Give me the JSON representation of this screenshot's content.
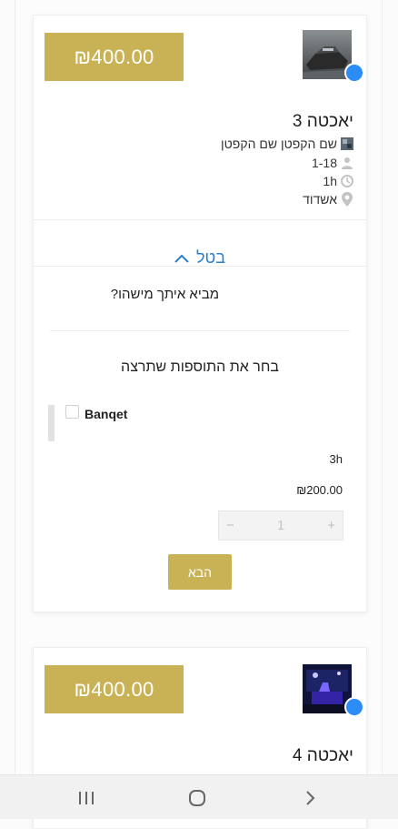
{
  "colors": {
    "accent_gold": "#c8b255",
    "status_blue": "#2b8cf5",
    "link_blue": "#2a7fd1"
  },
  "card1": {
    "price": "₪400.00",
    "title": "יאכטה 3",
    "captain": "שם הקפטן שם הקפטן",
    "guests": "1-18",
    "duration": "1h",
    "location": "אשדוד",
    "cancel_label": "בטל",
    "bring_question": "מביא איתך מישהו?",
    "choose_addons": "בחר את התוספות שתרצה",
    "addon": {
      "name": "Banqet",
      "duration": "3h",
      "price": "₪200.00",
      "quantity": "1"
    },
    "next_label": "הבא"
  },
  "card2": {
    "price": "₪400.00",
    "title": "יאכטה 4"
  },
  "icons": {
    "captain": "captain-image-icon",
    "guests": "person-icon",
    "duration": "clock-icon",
    "location": "location-pin-icon",
    "cancel": "chevron-up-icon",
    "status": "status-dot-icon"
  },
  "navbar": {
    "recent": "recent-apps-icon",
    "home": "home-icon",
    "back": "back-icon"
  }
}
